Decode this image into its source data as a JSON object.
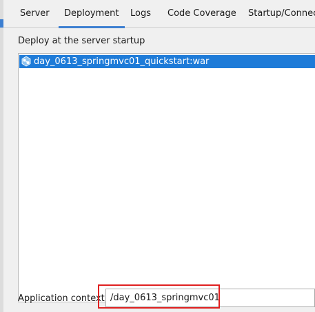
{
  "tabs": [
    {
      "label": "Server",
      "active": false
    },
    {
      "label": "Deployment",
      "active": true
    },
    {
      "label": "Logs",
      "active": false
    },
    {
      "label": "Code Coverage",
      "active": false
    },
    {
      "label": "Startup/Connecti",
      "active": false
    }
  ],
  "deployment": {
    "section_label": "Deploy at the server startup",
    "artifacts": [
      {
        "name": "day_0613_springmvc01_quickstart:war",
        "selected": true,
        "icon": "war-artifact-icon"
      }
    ]
  },
  "application_context": {
    "label": "Application context:",
    "value": "/day_0613_springmvc01"
  },
  "colors": {
    "selection": "#1e7bd8",
    "tab_underline": "#3c7fd1",
    "highlight": "#e02020"
  }
}
